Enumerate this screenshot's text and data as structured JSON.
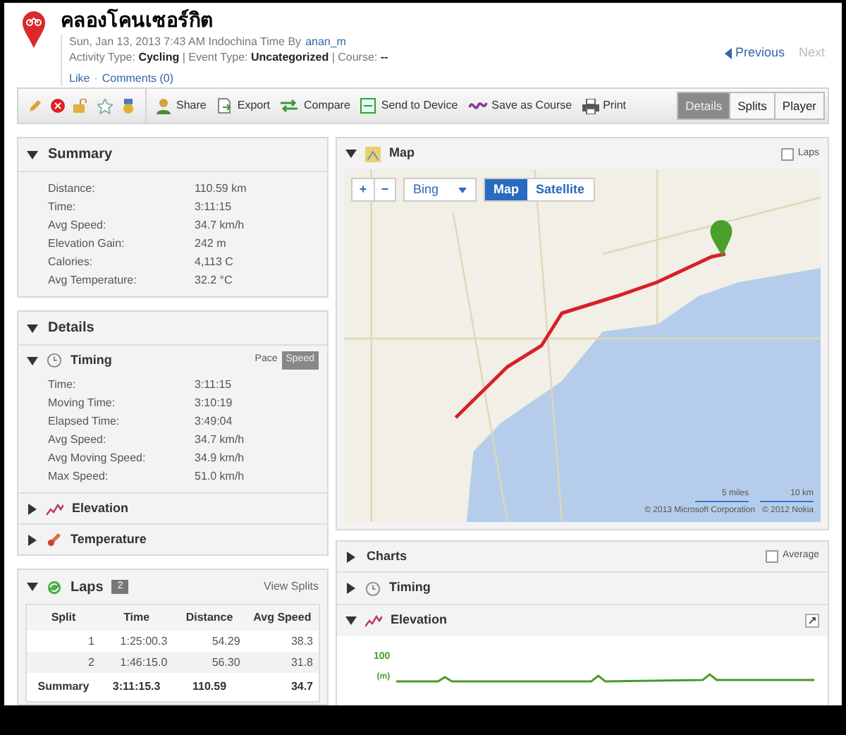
{
  "activity": {
    "title": "คลองโคนเซอร์กิต",
    "date": "Sun, Jan 13, 2013 7:43 AM Indochina Time By",
    "author": "anan_m",
    "meta": "Activity Type: **Cycling** | Event Type: **Uncategorized** | Course: **--**",
    "like": "Like",
    "separator": "·",
    "comments": "Comments (0)"
  },
  "nav": [
    {
      "kind": "previous",
      "label": "Previous",
      "disabled": false
    },
    {
      "kind": "next",
      "label": "Next",
      "disabled": true
    }
  ],
  "toolbar": {
    "actions": [
      {
        "kind": "share",
        "label": "Share"
      },
      {
        "kind": "export",
        "label": "Export"
      },
      {
        "kind": "compare",
        "label": "Compare"
      },
      {
        "kind": "send",
        "label": "Send to Device"
      },
      {
        "kind": "course",
        "label": "Save as Course"
      },
      {
        "kind": "print",
        "label": "Print"
      }
    ],
    "views": [
      {
        "label": "Details",
        "selected": true
      },
      {
        "label": "Splits",
        "selected": false
      },
      {
        "label": "Player",
        "selected": false
      }
    ]
  },
  "summary": {
    "title": "Summary",
    "expanded": true,
    "rows": [
      {
        "label": "Distance:",
        "value": "110.59 km"
      },
      {
        "label": "Time:",
        "value": "3:11:15"
      },
      {
        "label": "Avg Speed:",
        "value": "34.7 km/h"
      },
      {
        "label": "Elevation Gain:",
        "value": "242 m"
      },
      {
        "label": "Calories:",
        "value": "4,113 C"
      },
      {
        "label": "Avg Temperature:",
        "value": "32.2 °C"
      }
    ]
  },
  "details": {
    "title": "Details",
    "expanded": true,
    "sections": [
      {
        "kind": "timing",
        "title": "Timing",
        "expanded": true,
        "toggle": [
          {
            "label": "Pace",
            "selected": false
          },
          {
            "label": "Speed",
            "selected": true
          }
        ],
        "rows": [
          {
            "label": "Time:",
            "value": "3:11:15"
          },
          {
            "label": "Moving Time:",
            "value": "3:10:19"
          },
          {
            "label": "Elapsed Time:",
            "value": "3:49:04"
          },
          {
            "label": "Avg Speed:",
            "value": "34.7 km/h"
          },
          {
            "label": "Avg Moving Speed:",
            "value": "34.9 km/h"
          },
          {
            "label": "Max Speed:",
            "value": "51.0 km/h"
          }
        ]
      },
      {
        "kind": "elevation",
        "title": "Elevation",
        "expanded": false
      },
      {
        "kind": "temperature",
        "title": "Temperature",
        "expanded": false
      }
    ]
  },
  "laps": {
    "title": "Laps",
    "count": "2",
    "link": "View Splits",
    "expanded": true,
    "columns": [
      "Split",
      "Time",
      "Distance",
      "Avg Speed"
    ],
    "rows": [
      [
        "1",
        "1:25:00.3",
        "54.29",
        "38.3"
      ],
      [
        "2",
        "1:46:15.0",
        "56.30",
        "31.8"
      ]
    ],
    "summary": [
      "Summary",
      "3:11:15.3",
      "110.59",
      "34.7"
    ]
  },
  "map": {
    "title": "Map",
    "expanded": true,
    "laps_checkbox": {
      "label": "Laps",
      "checked": false
    },
    "zoom_in": "+",
    "zoom_out": "−",
    "provider": "Bing",
    "modes": [
      {
        "label": "Map",
        "selected": true
      },
      {
        "label": "Satellite",
        "selected": false
      }
    ],
    "scale": [
      "5 miles",
      "10 km"
    ],
    "copyright": [
      "© 2013 Microsoft Corporation",
      "© 2012 Nokia"
    ]
  },
  "charts": {
    "title": "Charts",
    "expanded": false,
    "average_checkbox": {
      "label": "Average",
      "checked": false
    },
    "sections": [
      {
        "kind": "timing",
        "title": "Timing",
        "expanded": false
      },
      {
        "kind": "elevation",
        "title": "Elevation",
        "expanded": true,
        "ytick": "100",
        "ylabel": "(m)"
      }
    ]
  }
}
